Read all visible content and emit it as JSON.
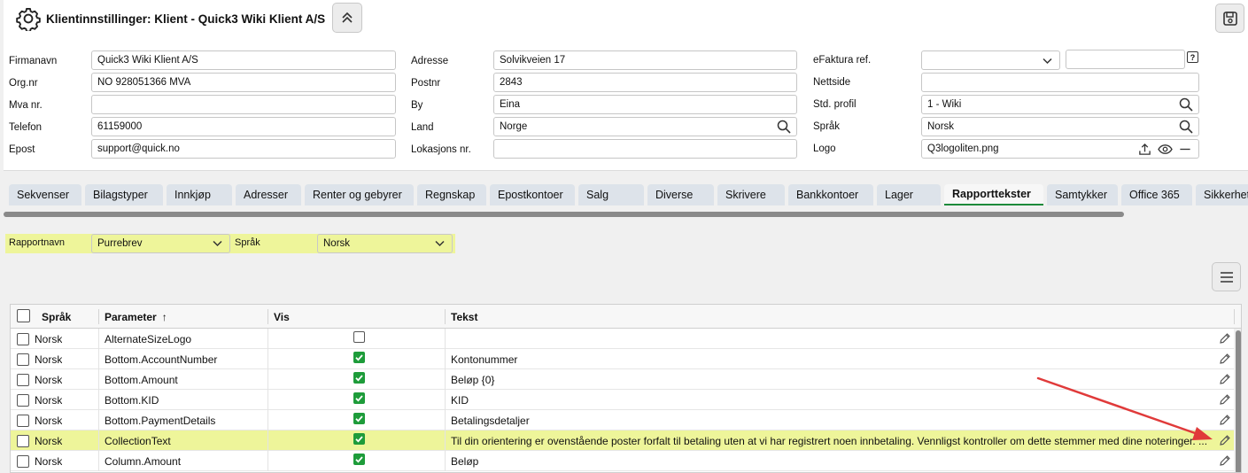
{
  "header": {
    "title": "Klientinnstillinger: Klient - Quick3 Wiki Klient A/S"
  },
  "form": {
    "col1": [
      {
        "label": "Firmanavn",
        "value": "Quick3 Wiki Klient A/S"
      },
      {
        "label": "Org.nr",
        "value": "NO 928051366 MVA"
      },
      {
        "label": "Mva nr.",
        "value": ""
      },
      {
        "label": "Telefon",
        "value": "61159000"
      },
      {
        "label": "Epost",
        "value": "support@quick.no"
      }
    ],
    "col2": [
      {
        "label": "Adresse",
        "value": "Solvikveien 17"
      },
      {
        "label": "Postnr",
        "value": "2843"
      },
      {
        "label": "By",
        "value": "Eina"
      },
      {
        "label": "Land",
        "value": "Norge"
      },
      {
        "label": "Lokasjons nr.",
        "value": ""
      }
    ],
    "col3": [
      {
        "label": "eFaktura ref.",
        "value": ""
      },
      {
        "label": "Nettside",
        "value": ""
      },
      {
        "label": "Std. profil",
        "value": "1 - Wiki"
      },
      {
        "label": "Språk",
        "value": "Norsk"
      },
      {
        "label": "Logo",
        "value": "Q3logoliten.png"
      }
    ],
    "efaktura_help": "?"
  },
  "tabs": [
    {
      "label": "Sekvenser"
    },
    {
      "label": "Bilagstyper"
    },
    {
      "label": "Innkjøp"
    },
    {
      "label": "Adresser"
    },
    {
      "label": "Renter og gebyrer"
    },
    {
      "label": "Regnskap"
    },
    {
      "label": "Epostkontoer"
    },
    {
      "label": "Salg"
    },
    {
      "label": "Diverse"
    },
    {
      "label": "Skrivere"
    },
    {
      "label": "Bankkontoer"
    },
    {
      "label": "Lager"
    },
    {
      "label": "Rapporttekster"
    },
    {
      "label": "Samtykker"
    },
    {
      "label": "Office 365"
    },
    {
      "label": "Sikkerhet"
    }
  ],
  "active_tab": "Rapporttekster",
  "filter": {
    "report_label": "Rapportnavn",
    "report_value": "Purrebrev",
    "lang_label": "Språk",
    "lang_value": "Norsk"
  },
  "table": {
    "columns": [
      "Språk",
      "Parameter",
      "Vis",
      "Tekst"
    ],
    "sort_indicator": "↑",
    "rows": [
      {
        "lang": "Norsk",
        "param": "AlternateSizeLogo",
        "vis": false,
        "text": ""
      },
      {
        "lang": "Norsk",
        "param": "Bottom.AccountNumber",
        "vis": true,
        "text": "Kontonummer"
      },
      {
        "lang": "Norsk",
        "param": "Bottom.Amount",
        "vis": true,
        "text": "Beløp {0}"
      },
      {
        "lang": "Norsk",
        "param": "Bottom.KID",
        "vis": true,
        "text": "KID"
      },
      {
        "lang": "Norsk",
        "param": "Bottom.PaymentDetails",
        "vis": true,
        "text": "Betalingsdetaljer"
      },
      {
        "lang": "Norsk",
        "param": "CollectionText",
        "vis": true,
        "text": "Til din orientering er ovenstående poster forfalt til betaling uten at vi har registrert noen innbetaling. Vennligst kontroller om dette stemmer med dine noteringer. ...",
        "highlight": true
      },
      {
        "lang": "Norsk",
        "param": "Column.Amount",
        "vis": true,
        "text": "Beløp"
      }
    ]
  },
  "colors": {
    "highlight": "#eef59a",
    "check_green": "#1e9c3a",
    "active_tab_underline": "#1d8a3a",
    "annotation_arrow": "#e03a3a"
  }
}
